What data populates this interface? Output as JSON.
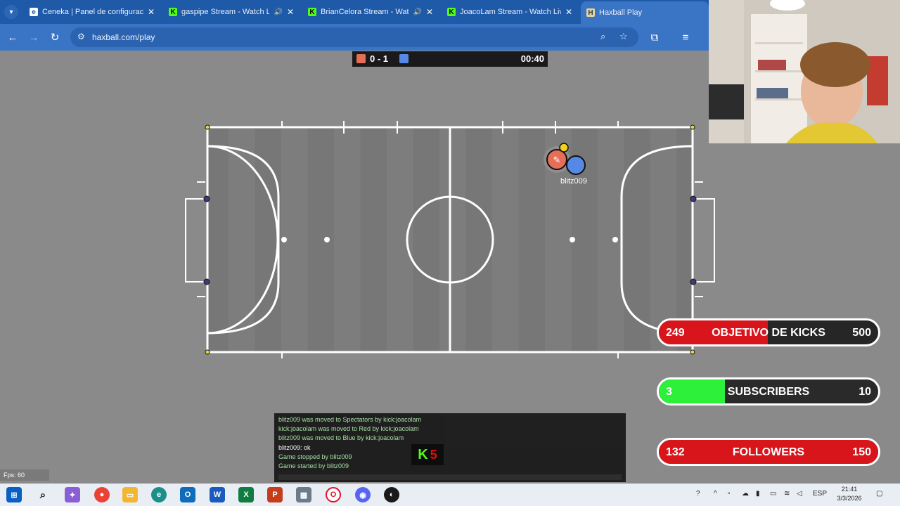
{
  "browser": {
    "tabs": [
      {
        "label": "Ceneka | Panel de configuración",
        "icon": "edge-e-icon",
        "active": false
      },
      {
        "label": "gaspipe Stream - Watch Live",
        "icon": "kick-icon",
        "active": false
      },
      {
        "label": "BrianCelora Stream - Watch",
        "icon": "kick-icon",
        "active": false
      },
      {
        "label": "JoacoLam Stream - Watch Live",
        "icon": "kick-icon",
        "active": false
      },
      {
        "label": "Haxball Play",
        "icon": "haxball-icon",
        "active": true
      }
    ],
    "url": "haxball.com/play"
  },
  "game": {
    "score": "0 - 1",
    "time": "00:40",
    "red_color": "#e56e56",
    "blue_color": "#5689e5",
    "player_name": "blitz009",
    "fps": "Fps: 60"
  },
  "chat": {
    "lines": [
      "blitz009 was moved to Spectators by kick:joacolam",
      "kick:joacolam was moved to Red by kick:joacolam",
      "blitz009 was moved to Blue by kick:joacolam",
      "blitz009: ok",
      "Game stopped by blitz009",
      "Game started by blitz009"
    ],
    "kick_badge_number": "5"
  },
  "goals": [
    {
      "current": "249",
      "label": "OBJETIVO DE KICKS",
      "target": "500",
      "progress": 0.498,
      "color": "#d9151c"
    },
    {
      "current": "3",
      "label": "SUBSCRIBERS",
      "target": "10",
      "progress": 0.3,
      "color": "#2cf03a"
    },
    {
      "current": "132",
      "label": "FOLLOWERS",
      "target": "150",
      "progress": 1.0,
      "color": "#d9151c"
    }
  ],
  "taskbar": {
    "language": "ESP",
    "time": "21:41",
    "date": "3/3/2026"
  }
}
